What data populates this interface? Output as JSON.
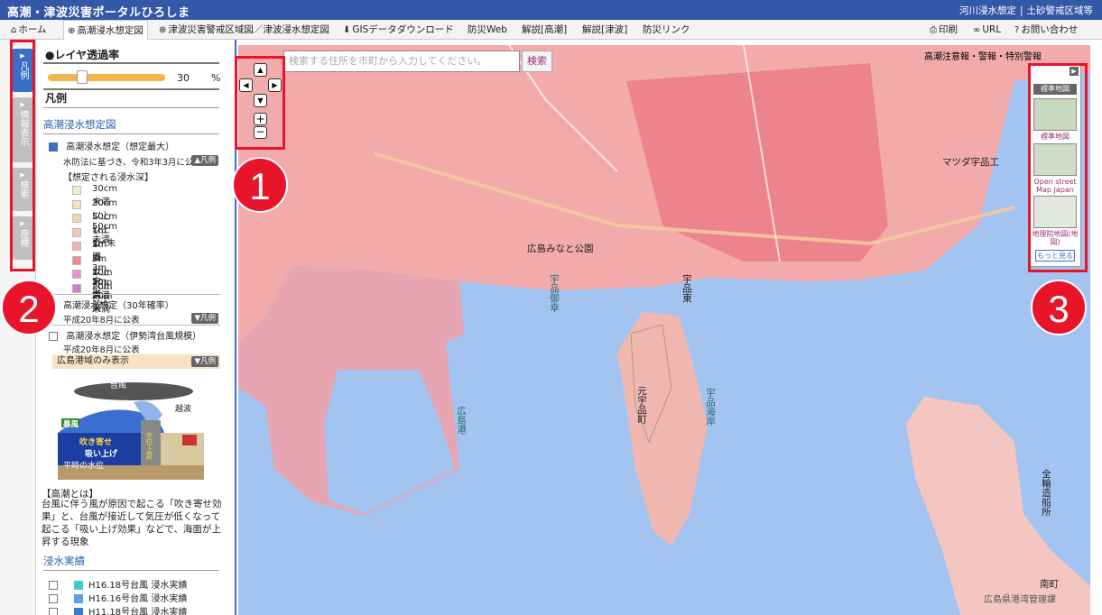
{
  "header": {
    "title": "高潮・津波災害ポータルひろしま",
    "links": [
      "河川浸水想定",
      "土砂警戒区域等"
    ]
  },
  "nav": {
    "home": "ホーム",
    "tabs": [
      "高潮浸水想定図",
      "津波災害警戒区域図／津波浸水想定図",
      "GISデータダウンロード",
      "防災Web",
      "解説[高潮]",
      "解説[津波]",
      "防災リンク"
    ],
    "right": [
      "印刷",
      "URL",
      "お問い合わせ"
    ]
  },
  "side_tabs": [
    "凡例",
    "情報表示",
    "検索",
    "座標"
  ],
  "panel": {
    "opacity_title": "●レイヤ透過率",
    "opacity_value": "30",
    "opacity_unit": "%",
    "legend_title": "凡例",
    "section_title": "高潮浸水想定図",
    "layer1": {
      "label": "高潮浸水想定（想定最大）",
      "note": "水防法に基づき、令和3年3月に公表",
      "toggle": "▲凡例",
      "depth_header": "【想定される浸水深】",
      "depths": [
        {
          "label": "30cm未満",
          "color": "#f5edc8"
        },
        {
          "label": "30cm以上50cm未満",
          "color": "#f5e3b0"
        },
        {
          "label": "50cm以上1m未満",
          "color": "#f0d6a4"
        },
        {
          "label": "1m以上3m未満",
          "color": "#f7c7b4"
        },
        {
          "label": "3m以上5m未満",
          "color": "#f4b1ad"
        },
        {
          "label": "5m以上10m未満",
          "color": "#ec8d8d"
        },
        {
          "label": "10m以上20m未満",
          "color": "#e296cc"
        },
        {
          "label": "20m以上",
          "color": "#d07ad0"
        }
      ]
    },
    "layer2": {
      "label": "高潮浸水想定（30年確率）",
      "note": "平成20年8月に公表",
      "toggle": "▼凡例"
    },
    "layer3": {
      "label": "高潮浸水想定（伊勢湾台風規模）",
      "note": "平成20年8月に公表",
      "band": "広島港域のみ表示",
      "toggle": "▼凡例"
    },
    "illustration": {
      "label_typhoon": "台風",
      "label_wave": "越波",
      "label_storm": "暴風",
      "label_blow": "吹き寄せ",
      "label_suck": "吸い上げ",
      "label_normal": "平時の水位",
      "label_rise": "水位上昇"
    },
    "explain_title": "【高潮とは】",
    "explain_text": "台風に伴う風が原因で起こる「吹き寄せ効果」と、台風が接近して気圧が低くなって起こる「吸い上げ効果」などで、海面が上昇する現象",
    "record_title": "浸水実績",
    "records": [
      {
        "label": "H16.18号台風 浸水実績",
        "color": "#45c8c8"
      },
      {
        "label": "H16.16号台風 浸水実績",
        "color": "#5aa0e0"
      },
      {
        "label": "H11.18号台風 浸水実績",
        "color": "#3a7ad0"
      }
    ]
  },
  "map": {
    "search_placeholder": "検索する住所を市町から入力してください。",
    "search_button": "検索",
    "alert_text": "高潮注意報・警報・特別警報",
    "labels": [
      "広島みなと公園",
      "元宇品町",
      "宇品東",
      "宇品海岸",
      "宇品御幸",
      "広島港",
      "南町",
      "マツダ宇品工",
      "広島県港湾管理課",
      "全輪造船所"
    ],
    "basemaps": [
      "標準地図",
      "Open street Map Japan",
      "地理院地図(地図)",
      "もっと見る"
    ],
    "basemap_header": "標準地図"
  },
  "callouts": [
    "1",
    "2",
    "3"
  ]
}
